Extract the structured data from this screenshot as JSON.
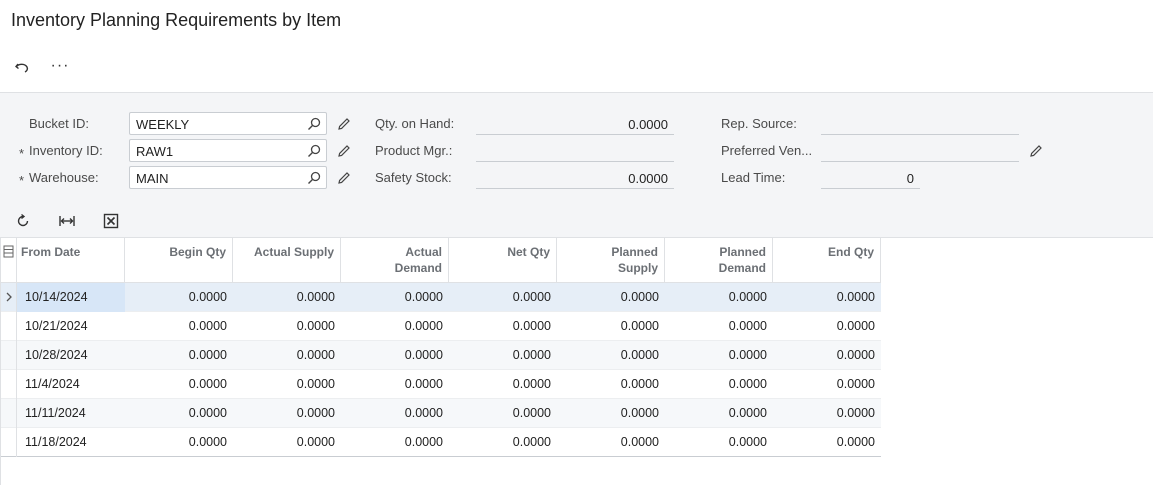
{
  "page": {
    "title": "Inventory Planning Requirements by Item"
  },
  "toolbar": {
    "undo_icon": "undo-icon",
    "more_label": "···"
  },
  "form": {
    "bucket_id": {
      "label": "Bucket ID:",
      "value": "WEEKLY"
    },
    "inventory_id": {
      "label": "Inventory ID:",
      "value": "RAW1",
      "required_mark": "*"
    },
    "warehouse": {
      "label": "Warehouse:",
      "value": "MAIN",
      "required_mark": "*"
    },
    "qty_on_hand": {
      "label": "Qty. on Hand:",
      "value": "0.0000"
    },
    "product_mgr": {
      "label": "Product Mgr.:",
      "value": ""
    },
    "safety_stock": {
      "label": "Safety Stock:",
      "value": "0.0000"
    },
    "rep_source": {
      "label": "Rep. Source:",
      "value": ""
    },
    "preferred_vendor": {
      "label": "Preferred Ven...",
      "value": ""
    },
    "lead_time": {
      "label": "Lead Time:",
      "value": "0"
    }
  },
  "grid": {
    "columns": {
      "from_date": "From Date",
      "begin_qty": "Begin Qty",
      "actual_supply": "Actual Supply",
      "actual_demand_1": "Actual",
      "actual_demand_2": "Demand",
      "net_qty": "Net Qty",
      "planned_supply_1": "Planned",
      "planned_supply_2": "Supply",
      "planned_demand_1": "Planned",
      "planned_demand_2": "Demand",
      "end_qty": "End Qty"
    },
    "rows": [
      {
        "from_date": "10/14/2024",
        "begin_qty": "0.0000",
        "actual_supply": "0.0000",
        "actual_demand": "0.0000",
        "net_qty": "0.0000",
        "planned_supply": "0.0000",
        "planned_demand": "0.0000",
        "end_qty": "0.0000"
      },
      {
        "from_date": "10/21/2024",
        "begin_qty": "0.0000",
        "actual_supply": "0.0000",
        "actual_demand": "0.0000",
        "net_qty": "0.0000",
        "planned_supply": "0.0000",
        "planned_demand": "0.0000",
        "end_qty": "0.0000"
      },
      {
        "from_date": "10/28/2024",
        "begin_qty": "0.0000",
        "actual_supply": "0.0000",
        "actual_demand": "0.0000",
        "net_qty": "0.0000",
        "planned_supply": "0.0000",
        "planned_demand": "0.0000",
        "end_qty": "0.0000"
      },
      {
        "from_date": "11/4/2024",
        "begin_qty": "0.0000",
        "actual_supply": "0.0000",
        "actual_demand": "0.0000",
        "net_qty": "0.0000",
        "planned_supply": "0.0000",
        "planned_demand": "0.0000",
        "end_qty": "0.0000"
      },
      {
        "from_date": "11/11/2024",
        "begin_qty": "0.0000",
        "actual_supply": "0.0000",
        "actual_demand": "0.0000",
        "net_qty": "0.0000",
        "planned_supply": "0.0000",
        "planned_demand": "0.0000",
        "end_qty": "0.0000"
      },
      {
        "from_date": "11/18/2024",
        "begin_qty": "0.0000",
        "actual_supply": "0.0000",
        "actual_demand": "0.0000",
        "net_qty": "0.0000",
        "planned_supply": "0.0000",
        "planned_demand": "0.0000",
        "end_qty": "0.0000"
      }
    ]
  },
  "colors": {
    "selected_row": "#e6eef7",
    "selected_cell": "#d7e6f7",
    "panel_bg": "#f4f5f7"
  }
}
